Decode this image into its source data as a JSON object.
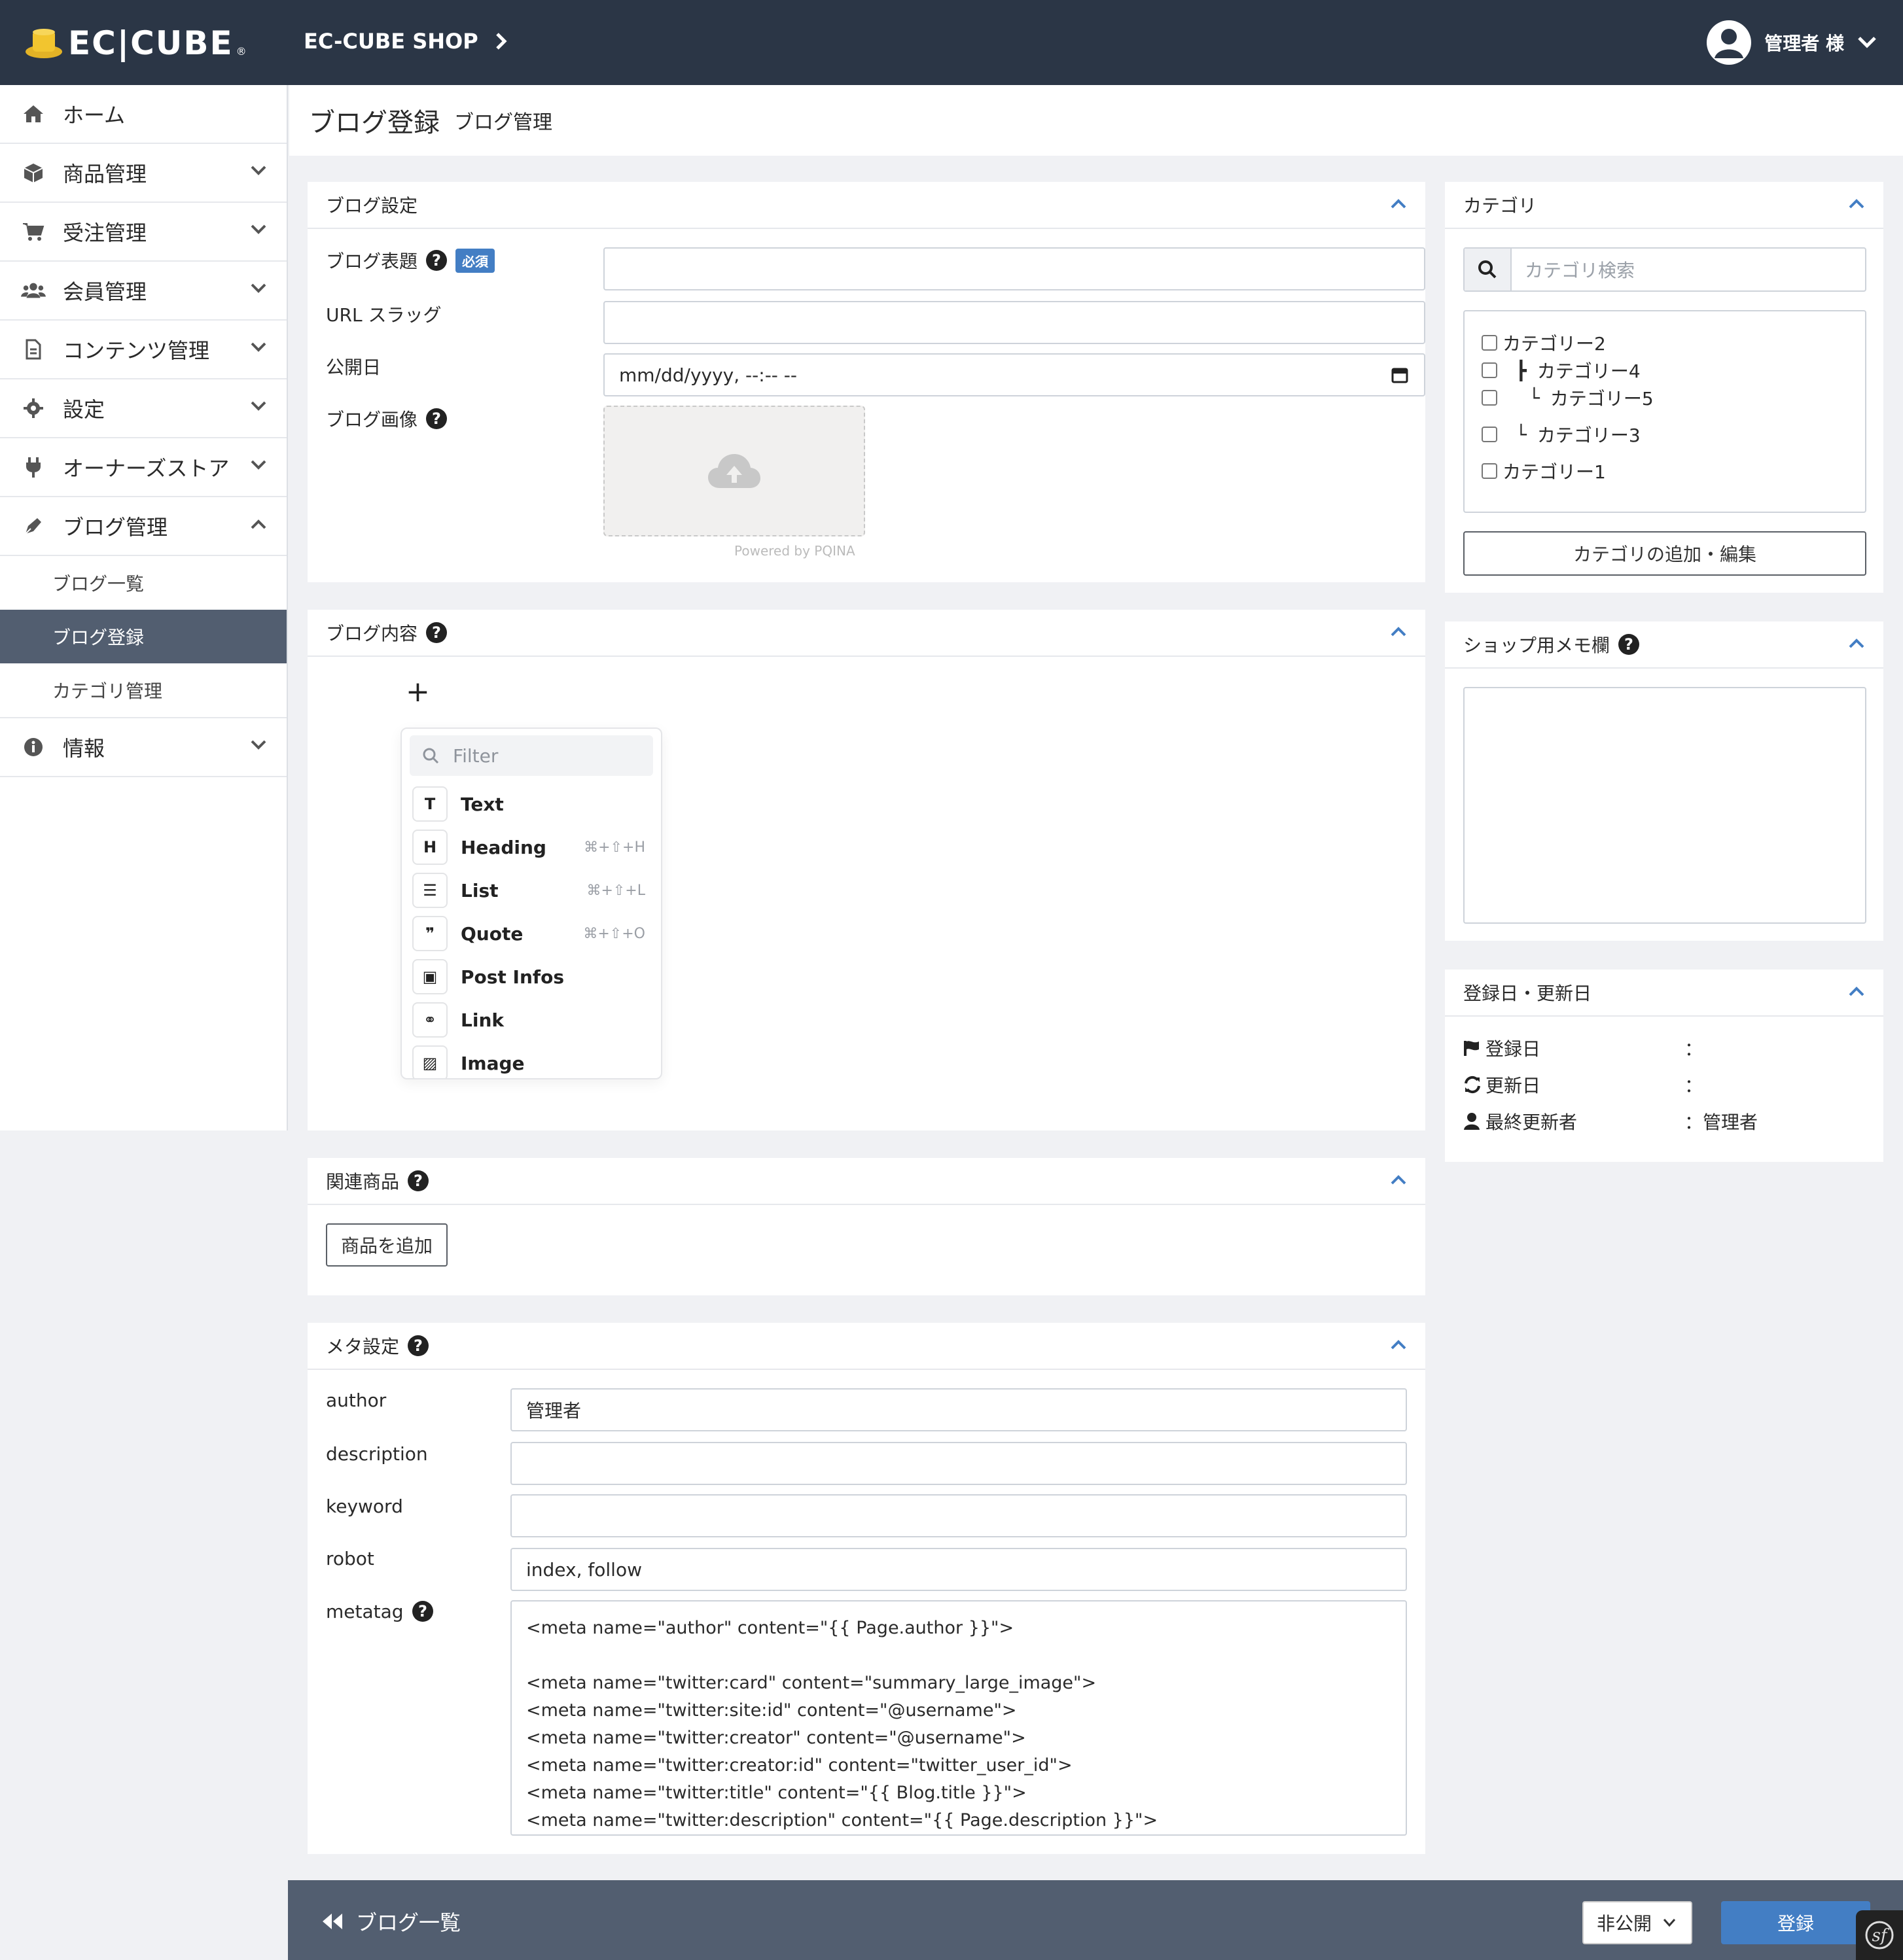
{
  "header": {
    "logo_text": "EC|CUBE",
    "shop_name": "EC-CUBE SHOP",
    "user_label": "管理者 様"
  },
  "sidebar": {
    "items": [
      {
        "label": "ホーム",
        "icon": "home-icon"
      },
      {
        "label": "商品管理",
        "icon": "box-icon"
      },
      {
        "label": "受注管理",
        "icon": "cart-icon"
      },
      {
        "label": "会員管理",
        "icon": "users-icon"
      },
      {
        "label": "コンテンツ管理",
        "icon": "file-icon"
      },
      {
        "label": "設定",
        "icon": "gear-icon"
      },
      {
        "label": "オーナーズストア",
        "icon": "plug-icon"
      },
      {
        "label": "ブログ管理",
        "icon": "pen-icon"
      },
      {
        "label": "情報",
        "icon": "info-icon"
      }
    ],
    "sub_items": [
      {
        "label": "ブログ一覧"
      },
      {
        "label": "ブログ登録"
      },
      {
        "label": "カテゴリ管理"
      }
    ]
  },
  "page": {
    "title": "ブログ登録",
    "subtitle": "ブログ管理"
  },
  "blog_settings": {
    "heading": "ブログ設定",
    "title_label": "ブログ表題",
    "required_badge": "必須",
    "slug_label": "URL スラッグ",
    "publish_label": "公開日",
    "publish_placeholder": "mm/dd/yyyy, --:-- --",
    "image_label": "ブログ画像",
    "powered_by": "Powered by PQINA"
  },
  "blog_content": {
    "heading": "ブログ内容",
    "add_symbol": "+",
    "filter_placeholder": "Filter",
    "blocks": [
      {
        "label": "Text",
        "glyph": "T",
        "shortcut": ""
      },
      {
        "label": "Heading",
        "glyph": "H",
        "shortcut": "⌘+⇧+H"
      },
      {
        "label": "List",
        "glyph": "☰",
        "shortcut": "⌘+⇧+L"
      },
      {
        "label": "Quote",
        "glyph": "❞",
        "shortcut": "⌘+⇧+O"
      },
      {
        "label": "Post Infos",
        "glyph": "▣",
        "shortcut": ""
      },
      {
        "label": "Link",
        "glyph": "⚭",
        "shortcut": ""
      },
      {
        "label": "Image",
        "glyph": "▨",
        "shortcut": ""
      }
    ]
  },
  "related_products": {
    "heading": "関連商品",
    "add_button": "商品を追加"
  },
  "meta": {
    "heading": "メタ設定",
    "author_label": "author",
    "author_value": "管理者",
    "description_label": "description",
    "keyword_label": "keyword",
    "robot_label": "robot",
    "robot_value": "index, follow",
    "metatag_label": "metatag",
    "metatag_value": "<meta name=\"author\" content=\"{{ Page.author }}\">\n\n<meta name=\"twitter:card\" content=\"summary_large_image\">\n<meta name=\"twitter:site:id\" content=\"@username\">\n<meta name=\"twitter:creator\" content=\"@username\">\n<meta name=\"twitter:creator:id\" content=\"twitter_user_id\">\n<meta name=\"twitter:title\" content=\"{{ Blog.title }}\">\n<meta name=\"twitter:description\" content=\"{{ Page.description }}\">"
  },
  "category": {
    "heading": "カテゴリ",
    "search_placeholder": "カテゴリ検索",
    "items": [
      {
        "label": "カテゴリー2",
        "prefix": ""
      },
      {
        "label": "カテゴリー4",
        "prefix": "┣"
      },
      {
        "label": "カテゴリー5",
        "prefix": "└"
      },
      {
        "label": "カテゴリー3",
        "prefix": "└"
      },
      {
        "label": "カテゴリー1",
        "prefix": ""
      }
    ],
    "edit_button": "カテゴリの追加・編集"
  },
  "memo": {
    "heading": "ショップ用メモ欄"
  },
  "dates": {
    "heading": "登録日・更新日",
    "created_label": "登録日",
    "updated_label": "更新日",
    "last_editor_label": "最終更新者",
    "created_value": "：",
    "updated_value": "：",
    "last_editor_value": "：管理者"
  },
  "footer": {
    "back_label": "ブログ一覧",
    "status_value": "非公開",
    "submit_label": "登録"
  },
  "colors": {
    "header_bg": "#2b3646",
    "accent": "#437ec4",
    "footer_bg": "#525e70"
  }
}
